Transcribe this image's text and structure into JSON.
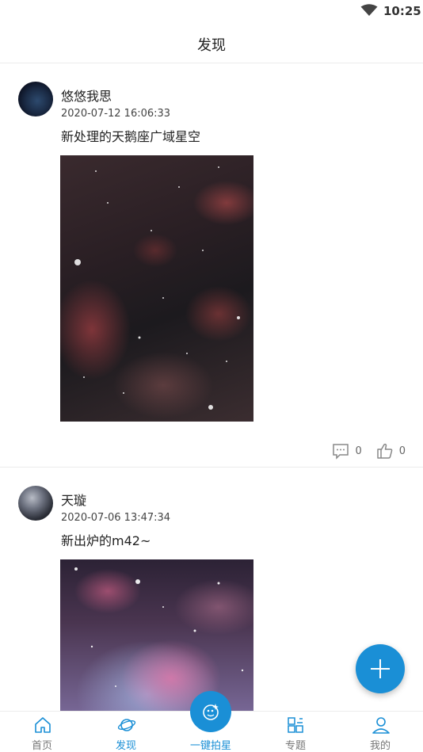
{
  "status_bar": {
    "time": "10:25"
  },
  "header": {
    "title": "发现"
  },
  "posts": [
    {
      "author": "悠悠我思",
      "timestamp": "2020-07-12 16:06:33",
      "caption": "新处理的天鹅座广域星空",
      "comments": "0",
      "likes": "0"
    },
    {
      "author": "天璇",
      "timestamp": "2020-07-06 13:47:34",
      "caption": "新出炉的m42~"
    }
  ],
  "nav": {
    "items": [
      {
        "label": "首页",
        "icon": "home-icon"
      },
      {
        "label": "发现",
        "icon": "planet-icon"
      },
      {
        "label": "一键拍星",
        "icon": "camera-star-icon"
      },
      {
        "label": "专题",
        "icon": "topics-icon"
      },
      {
        "label": "我的",
        "icon": "profile-icon"
      }
    ],
    "active": "发现"
  },
  "colors": {
    "accent": "#1a8fd6",
    "text": "#222222",
    "muted": "#777777"
  },
  "fab": {
    "icon": "plus-icon"
  }
}
